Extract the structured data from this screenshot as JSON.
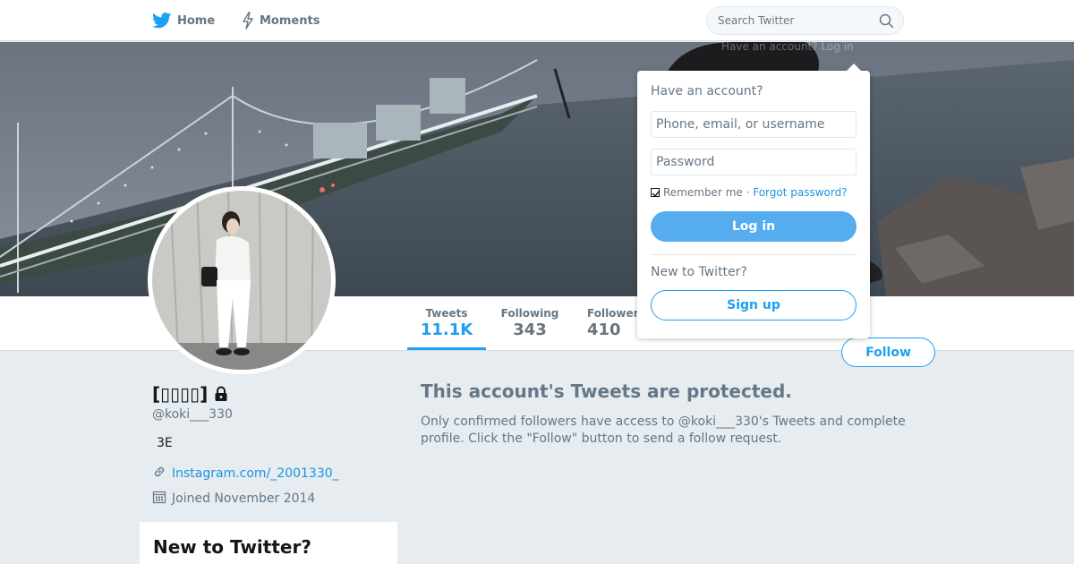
{
  "nav": {
    "home_label": "Home",
    "moments_label": "Moments",
    "search_placeholder": "Search Twitter"
  },
  "banner": {
    "ghost_text": "Have an account? Log in"
  },
  "profile": {
    "name": "[▯▯▯▯]",
    "handle": "@koki___330",
    "bio": "3E",
    "link": "Instagram.com/_2001330_",
    "joined": "Joined November 2014"
  },
  "stats": {
    "tweets_label": "Tweets",
    "tweets_value": "11.1K",
    "following_label": "Following",
    "following_value": "343",
    "followers_label": "Followers",
    "followers_value": "410"
  },
  "follow_label": "Follow",
  "protected": {
    "title": "This account's Tweets are protected.",
    "text": "Only confirmed followers have access to @koki___330's Tweets and complete profile. Click the \"Follow\" button to send a follow request."
  },
  "signup_card": {
    "title": "New to Twitter?"
  },
  "login": {
    "heading": "Have an account?",
    "username_placeholder": "Phone, email, or username",
    "password_placeholder": "Password",
    "remember_label": "Remember me",
    "separator": " · ",
    "forgot_label": "Forgot password?",
    "login_label": "Log in",
    "new_heading": "New to Twitter?",
    "signup_label": "Sign up"
  },
  "colors": {
    "accent": "#1da1f2",
    "login_button": "#55acee",
    "background": "#e6ecf0",
    "muted_text": "#657786"
  }
}
